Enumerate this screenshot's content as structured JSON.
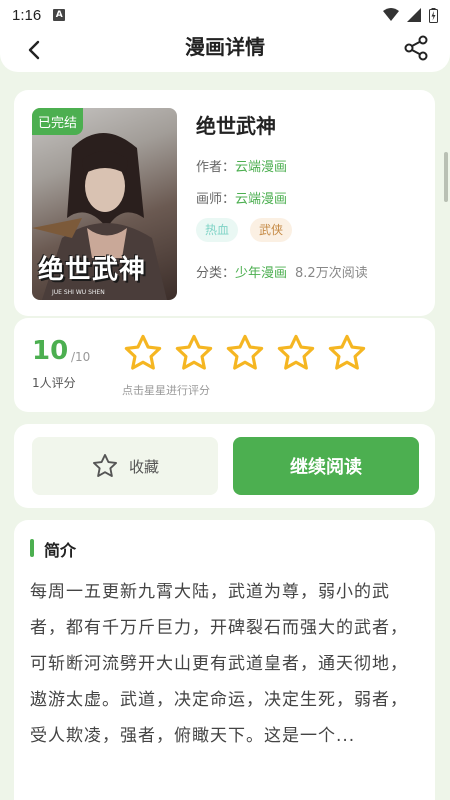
{
  "status_bar": {
    "time": "1:16",
    "notif": "A"
  },
  "header": {
    "title": "漫画详情"
  },
  "comic": {
    "cover_badge": "已完结",
    "cover_title": "绝世武神",
    "cover_sub": "JUE SHI WU SHEN",
    "title": "绝世武神",
    "author_label": "作者：",
    "author": "云端漫画",
    "artist_label": "画师：",
    "artist": "云端漫画",
    "tags": [
      "热血",
      "武侠"
    ],
    "category_label": "分类：",
    "category": "少年漫画",
    "views": "8.2万次阅读"
  },
  "rating": {
    "score": "10",
    "max": "/10",
    "raters": "1人评分",
    "hint": "点击星星进行评分",
    "stars": 5,
    "star_color": "#f5b622"
  },
  "actions": {
    "favorite": "收藏",
    "continue": "继续阅读"
  },
  "intro": {
    "title": "简介",
    "text": "每周一五更新九霄大陆，武道为尊，弱小的武者，都有千万斤巨力，开碑裂石而强大的武者，可斩断河流劈开大山更有武道皇者，通天彻地，遨游太虚。武道，决定命运，决定生死，弱者，受人欺凌，强者，俯瞰天下。这是一个..."
  },
  "colors": {
    "accent": "#4caf50",
    "background": "#eef5e9"
  }
}
